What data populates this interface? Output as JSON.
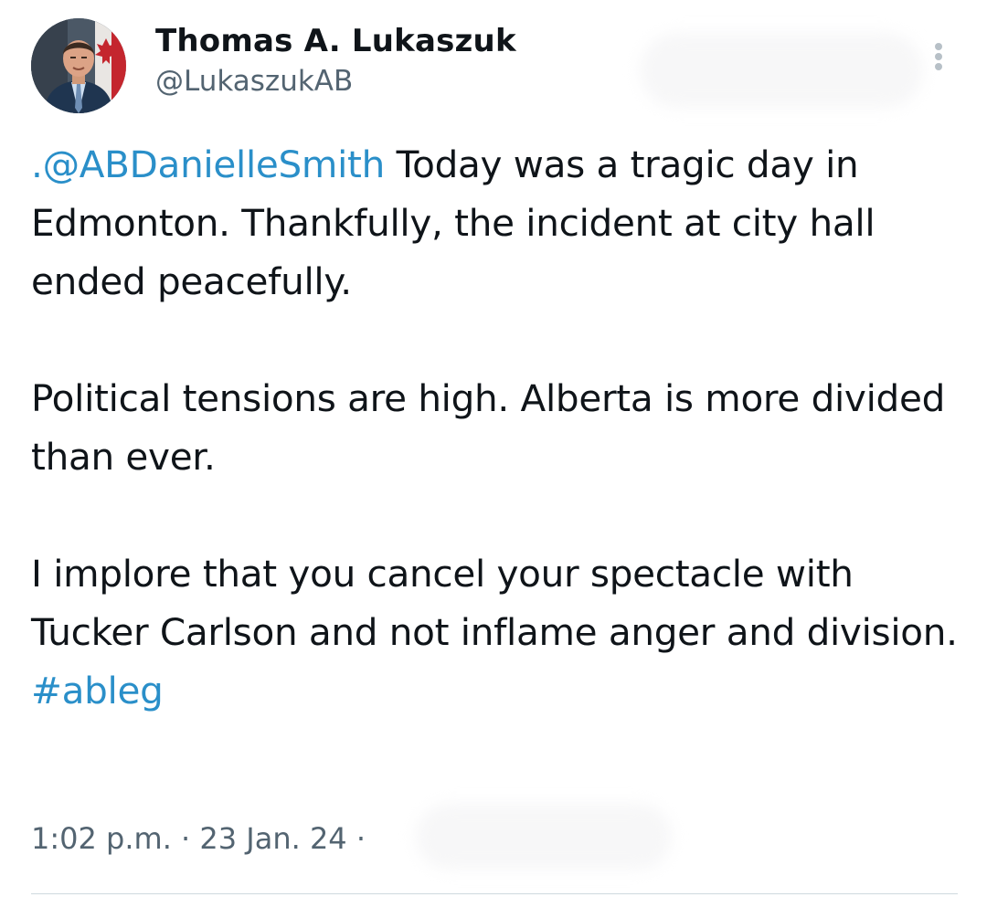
{
  "author": {
    "display_name": "Thomas A. Lukaszuk",
    "handle": "@LukaszukAB"
  },
  "tweet": {
    "mention": ".@ABDanielleSmith",
    "paragraph1_rest": " Today was a tragic day in Edmonton. Thankfully, the incident at city hall ended peacefully.",
    "paragraph2": "Political tensions are high. Alberta is more divided than ever.",
    "paragraph3": "I implore that you cancel your spectacle with Tucker Carlson and not inflame anger and division.",
    "hashtag": "#ableg"
  },
  "meta": {
    "time": "1:02 p.m.",
    "separator": " · ",
    "date": "23 Jan. 24",
    "trailing_separator": " ·"
  },
  "icons": {
    "more": "more-vertical-icon",
    "avatar": "avatar"
  },
  "colors": {
    "link": "#2a8fc9",
    "text": "#0f1419",
    "secondary": "#536471"
  }
}
